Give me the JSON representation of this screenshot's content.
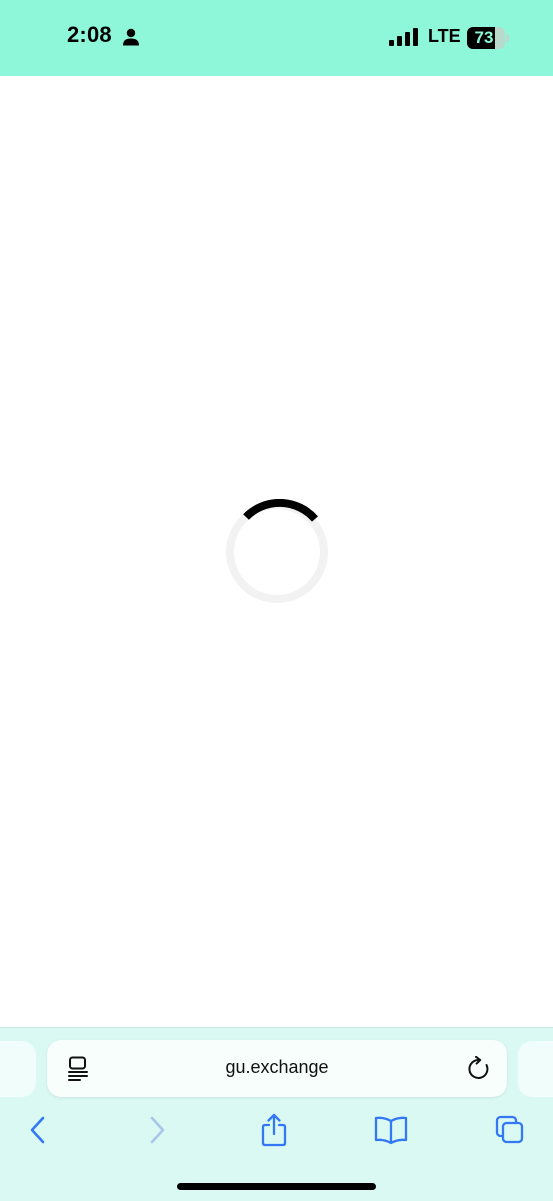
{
  "status_bar": {
    "time": "2:08",
    "network": "LTE",
    "battery_level": "73",
    "battery_fraction": 0.73,
    "background_color": "#8ef7d9"
  },
  "page": {
    "state": "loading",
    "spinner_color": "#000000",
    "spinner_track_color": "#f2f2f2"
  },
  "browser": {
    "url": "gu.exchange",
    "accent_color": "#3478f6",
    "icons": {
      "reader": "reader-mode-icon",
      "reload": "reload-icon",
      "back": "back-chevron-icon",
      "forward": "forward-chevron-icon",
      "share": "share-icon",
      "bookmarks": "bookmarks-book-icon",
      "tabs": "tabs-icon"
    }
  }
}
